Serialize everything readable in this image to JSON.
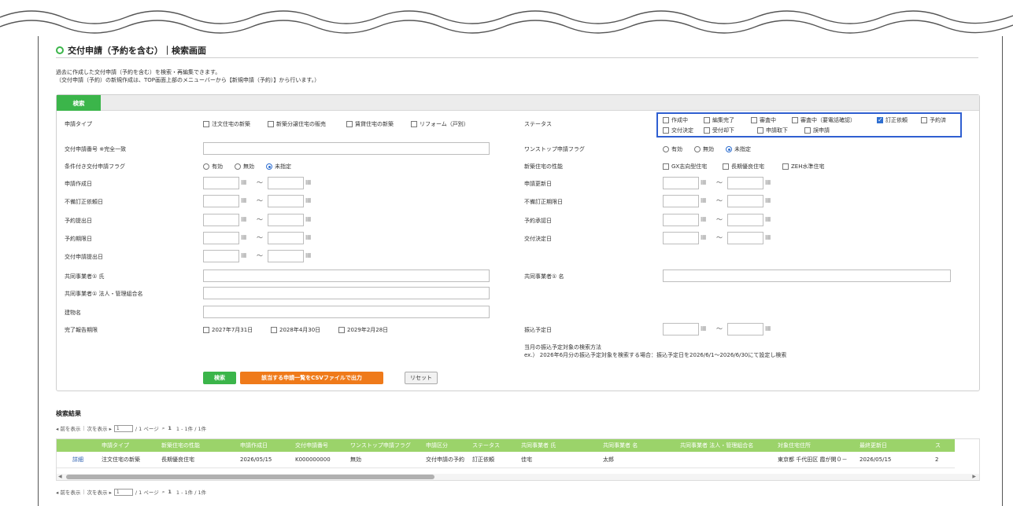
{
  "page": {
    "title": "交付申請（予約を含む）｜検索画面",
    "desc_line1": "過去に作成した交付申請（予約を含む）を検索・再編集できます。",
    "desc_line2": "（交付申請（予約）の新規作成は、TOP画面上部のメニューバーから【新規申請（予約）】から行います。）"
  },
  "search": {
    "tab_label": "検索",
    "labels": {
      "shinsei_type": "申請タイプ",
      "kofu_no": "交付申請番号 ※完全一致",
      "joken_flag": "条件付き交付申請フラグ",
      "sakusei_bi": "申請作成日",
      "fubi_irai_bi": "不備訂正依頼日",
      "yoyaku_teishutsu_bi": "予約提出日",
      "yoyaku_kigen_bi": "予約期限日",
      "kofu_teishutsu_bi": "交付申請提出日",
      "kyodo_shi": "共同事業者① 氏",
      "kyodo_hojin": "共同事業者① 法人・管理組合名",
      "tatemono": "建物名",
      "kanryo": "完了報告期限",
      "status": "ステータス",
      "onestop": "ワンストップ申請フラグ",
      "seino": "新築住宅の性能",
      "koshin_bi": "申請更新日",
      "fubi_kigen_bi": "不備訂正期限日",
      "yoyaku_shonin_bi": "予約承認日",
      "kofu_kettei_bi": "交付決定日",
      "kyodo_mei": "共同事業者① 名",
      "furikomi_bi": "振込予定日"
    },
    "type_options": [
      "注文住宅の新築",
      "新築分譲住宅の販売",
      "賃貸住宅の新築",
      "リフォーム（戸別）"
    ],
    "status_row1": [
      {
        "label": "作成中",
        "checked": false
      },
      {
        "label": "編集完了",
        "checked": false
      },
      {
        "label": "審査中",
        "checked": false
      },
      {
        "label": "審査中（要電話確認）",
        "checked": false
      },
      {
        "label": "訂正依頼",
        "checked": true
      },
      {
        "label": "予約済",
        "checked": false
      }
    ],
    "status_row2": [
      {
        "label": "交付決定",
        "checked": false
      },
      {
        "label": "受付却下",
        "checked": false
      },
      {
        "label": "申請取下",
        "checked": false
      },
      {
        "label": "誤申請",
        "checked": false
      }
    ],
    "radio": {
      "yuko": "有効",
      "muko": "無効",
      "mishitei": "未指定"
    },
    "seino_options": [
      "GX志向型住宅",
      "長期優良住宅",
      "ZEH水準住宅"
    ],
    "kanryo_options": [
      "2027年7月31日",
      "2028年4月30日",
      "2029年2月28日"
    ],
    "tilde": "～",
    "cal_icon": "calendar-icon",
    "furikomi_note1": "当月の振込予定対象の検索方法",
    "furikomi_note2": "ex.） 2026年6月分の振込予定対象を検索する場合：振込予定日を2026/6/1～2026/6/30にて設定し検索",
    "btn_search": "検索",
    "btn_csv": "該当する申請一覧をCSVファイルで出力",
    "btn_reset": "リセット"
  },
  "results": {
    "title": "検索結果",
    "pager": {
      "prev": "◂ 前を表示",
      "next": "次を表示 ▸",
      "page_input": "1",
      "page_total": "/ 1 ページ",
      "page_icon": "search-icon",
      "current": "1",
      "range": "1 - 1件 / 1件"
    },
    "headers": [
      "",
      "申請タイプ",
      "新築住宅の性能",
      "申請作成日",
      "交付申請番号",
      "ワンストップ申請フラグ",
      "申請区分",
      "ステータス",
      "共同事業者 氏",
      "共同事業者 名",
      "共同事業者 法人・管理組合名",
      "対象住宅住所",
      "最終更新日",
      "ス"
    ],
    "rows": [
      [
        "詳細",
        "注文住宅の新築",
        "長期優良住宅",
        "2026/05/15",
        "K000000000",
        "無効",
        "交付申請の予約",
        "訂正依頼",
        "佳宅",
        "太郎",
        "",
        "東京都 千代田区 霞が関０－",
        "2026/05/15",
        "2"
      ]
    ]
  },
  "colors": {
    "green": "#3bb54a",
    "orange": "#ef7a1a",
    "blue_highlight": "#2f5fd1",
    "header_green": "#9bd36a"
  }
}
